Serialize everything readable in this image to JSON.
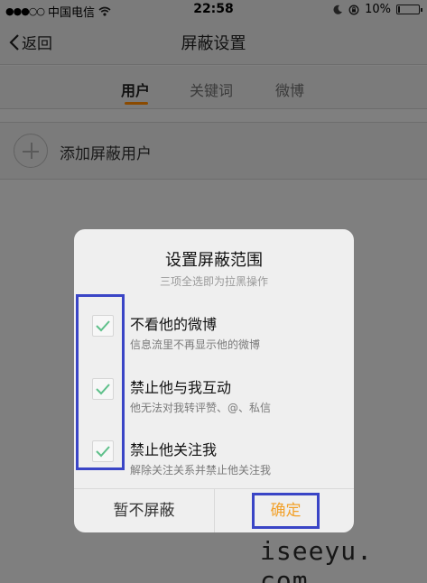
{
  "status_bar": {
    "carrier": "中国电信",
    "time": "22:58",
    "battery": "10%",
    "battery_level": 0.1
  },
  "nav": {
    "back_label": "返回",
    "title": "屏蔽设置"
  },
  "tabs": [
    {
      "label": "用户",
      "active": true
    },
    {
      "label": "关键词",
      "active": false
    },
    {
      "label": "微博",
      "active": false
    }
  ],
  "add_user": {
    "label": "添加屏蔽用户"
  },
  "dialog": {
    "title": "设置屏蔽范围",
    "subtitle": "三项全选即为拉黑操作",
    "options": [
      {
        "label": "不看他的微博",
        "description": "信息流里不再显示他的微博",
        "checked": true
      },
      {
        "label": "禁止他与我互动",
        "description": "他无法对我转评赞、@、私信",
        "checked": true
      },
      {
        "label": "禁止他关注我",
        "description": "解除关注关系并禁止他关注我",
        "checked": true
      }
    ],
    "cancel_label": "暂不屏蔽",
    "confirm_label": "确定"
  },
  "watermark": "iseeyu. com",
  "colors": {
    "accent": "#f2a12a",
    "check": "#5ec08a",
    "annotation_box": "#3a45c6",
    "tab_underline": "#8a4a00"
  }
}
